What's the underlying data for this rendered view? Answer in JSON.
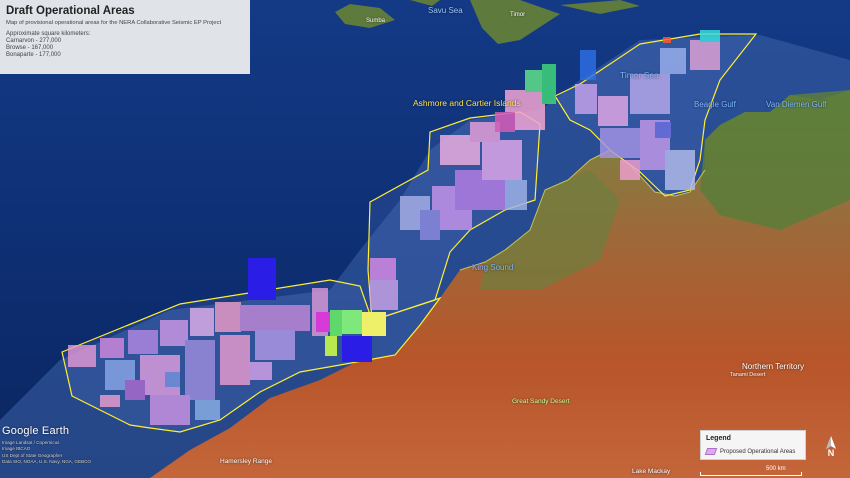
{
  "info": {
    "title": "Draft Operational Areas",
    "subtitle": "Map of provisional operational areas for the NERA Collaborative Seismic EP Project",
    "areas_heading": "Approximate square kilometers:",
    "areas": [
      "Carnarvon - 277,000",
      "Browse - 167,000",
      "Bonaparte - 177,000"
    ]
  },
  "labels": [
    {
      "text": "Savu Sea",
      "color": "#9ec7ff"
    },
    {
      "text": "Timor",
      "color": "#ffffff"
    },
    {
      "text": "Sumba",
      "color": "#ffffff"
    },
    {
      "text": "Ashmore and Cartier Islands",
      "color": "#ffe24a"
    },
    {
      "text": "Timor Sea",
      "color": "#7fb6ff"
    },
    {
      "text": "Beagle Gulf",
      "color": "#7fb6ff"
    },
    {
      "text": "Van Diemen Gulf",
      "color": "#7fb6ff"
    },
    {
      "text": "King Sound",
      "color": "#7fb6ff"
    },
    {
      "text": "Northern Territory",
      "color": "#ffffff"
    },
    {
      "text": "Tanami Desert",
      "color": "#ffffff"
    },
    {
      "text": "Great Sandy Desert",
      "color": "#c6ff9a"
    },
    {
      "text": "Hamersley Range",
      "color": "#ffffff"
    },
    {
      "text": "Lake Mackay",
      "color": "#ffffff"
    }
  ],
  "legend": {
    "title": "Legend",
    "items": [
      {
        "label": "Proposed Operational Areas",
        "color": "#d78ceb"
      }
    ]
  },
  "branding": {
    "logo": "Google Earth",
    "credits": [
      "Image Landsat / Copernicus",
      "Data SIO, NOAA, U.S. Navy, NGA, GEBCO",
      "US Dept of State Geographer",
      "Image IBCAO"
    ]
  },
  "scale": {
    "label": "500 km"
  },
  "north": {
    "label": "N",
    "icon": "north-arrow-icon"
  },
  "colors": {
    "boundary": "#ffee33",
    "operational_area": "#d78ceb",
    "ocean_deep": "#0e2b6b",
    "land": "#b5542a"
  }
}
